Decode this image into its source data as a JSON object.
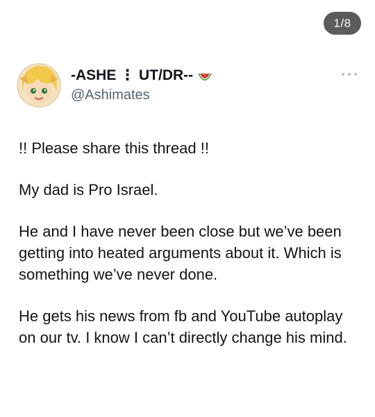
{
  "page_counter": "1/8",
  "author": {
    "display_name": "-ASHE ⋮ UT/DR--",
    "handle": "@Ashimates",
    "avatar_icon": "cartoon-avatar-icon",
    "name_emoji_icon": "watermelon-icon"
  },
  "tweet": {
    "paragraphs": [
      "!! Please share this thread !!",
      "My dad is Pro Israel.",
      "He and I have never been close but we’ve been getting into heated arguments about it. Which is something we’ve never done.",
      "He gets his news from fb and YouTube autoplay on our tv.  I know I can’t directly change his mind."
    ]
  },
  "more_button_icon": "more-options-icon",
  "colors": {
    "background": "#ffffff",
    "text": "#0f1419",
    "secondary_text": "#536471",
    "counter_bg": "#5b5b5b"
  }
}
